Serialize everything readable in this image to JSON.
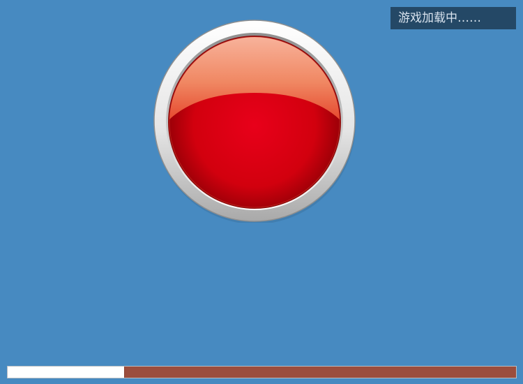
{
  "status": {
    "loading_text": "游戏加载中……"
  },
  "start_button": {
    "icon": "red-glossy-button-icon",
    "color": "#d9000f"
  },
  "progress": {
    "value": 0.23,
    "fill_color": "#ffffff",
    "track_color": "#9b4d3d"
  },
  "colors": {
    "background": "#478ac1",
    "banner": "#244866"
  }
}
